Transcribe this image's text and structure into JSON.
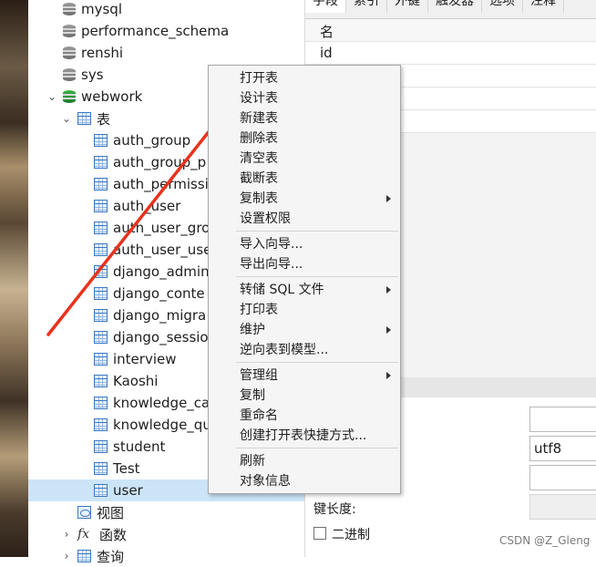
{
  "tree": {
    "items": [
      {
        "label": "mysql",
        "icon": "database-icon",
        "color": "gray"
      },
      {
        "label": "performance_schema",
        "icon": "database-icon",
        "color": "gray"
      },
      {
        "label": "renshi",
        "icon": "database-icon",
        "color": "gray"
      },
      {
        "label": "sys",
        "icon": "database-icon",
        "color": "gray"
      },
      {
        "label": "webwork",
        "icon": "database-icon",
        "color": "green",
        "expanded": true
      },
      {
        "label": "表",
        "icon": "table-icon",
        "expanded": true
      },
      {
        "label": "auth_group",
        "icon": "table-icon"
      },
      {
        "label": "auth_group_p",
        "icon": "table-icon"
      },
      {
        "label": "auth_permissio",
        "icon": "table-icon"
      },
      {
        "label": "auth_user",
        "icon": "table-icon"
      },
      {
        "label": "auth_user_gro",
        "icon": "table-icon"
      },
      {
        "label": "auth_user_use",
        "icon": "table-icon"
      },
      {
        "label": "django_admin",
        "icon": "table-icon"
      },
      {
        "label": "django_conte",
        "icon": "table-icon"
      },
      {
        "label": "django_migra",
        "icon": "table-icon"
      },
      {
        "label": "django_sessio",
        "icon": "table-icon"
      },
      {
        "label": "interview",
        "icon": "table-icon"
      },
      {
        "label": "Kaoshi",
        "icon": "table-icon"
      },
      {
        "label": "knowledge_ca",
        "icon": "table-icon"
      },
      {
        "label": "knowledge_qu",
        "icon": "table-icon"
      },
      {
        "label": "student",
        "icon": "table-icon"
      },
      {
        "label": "Test",
        "icon": "table-icon"
      },
      {
        "label": "user",
        "icon": "table-icon",
        "selected": true
      },
      {
        "label": "视图",
        "icon": "view-icon"
      },
      {
        "label": "函数",
        "icon": "function-icon"
      },
      {
        "label": "查询",
        "icon": "query-icon"
      }
    ]
  },
  "tabs": [
    {
      "label": "字段"
    },
    {
      "label": "索引"
    },
    {
      "label": "外键"
    },
    {
      "label": "触发器"
    },
    {
      "label": "选项"
    },
    {
      "label": "注释"
    }
  ],
  "grid": {
    "header": "名",
    "rows": [
      "id"
    ]
  },
  "properties": {
    "charset_value": "utf8",
    "key_length_label": "键长度:",
    "binary_label": "二进制"
  },
  "context_menu": {
    "items": [
      {
        "label": "打开表"
      },
      {
        "label": "设计表"
      },
      {
        "label": "新建表"
      },
      {
        "label": "删除表"
      },
      {
        "label": "清空表"
      },
      {
        "label": "截断表"
      },
      {
        "label": "复制表",
        "submenu": true
      },
      {
        "label": "设置权限"
      },
      {
        "label": "导入向导..."
      },
      {
        "label": "导出向导..."
      },
      {
        "label": "转储 SQL 文件",
        "submenu": true
      },
      {
        "label": "打印表"
      },
      {
        "label": "维护",
        "submenu": true
      },
      {
        "label": "逆向表到模型..."
      },
      {
        "label": "管理组",
        "submenu": true
      },
      {
        "label": "复制"
      },
      {
        "label": "重命名"
      },
      {
        "label": "创建打开表快捷方式..."
      },
      {
        "label": "刷新"
      },
      {
        "label": "对象信息"
      }
    ]
  },
  "annotation_color": "#e8321c",
  "watermark": "CSDN @Z_Gleng"
}
